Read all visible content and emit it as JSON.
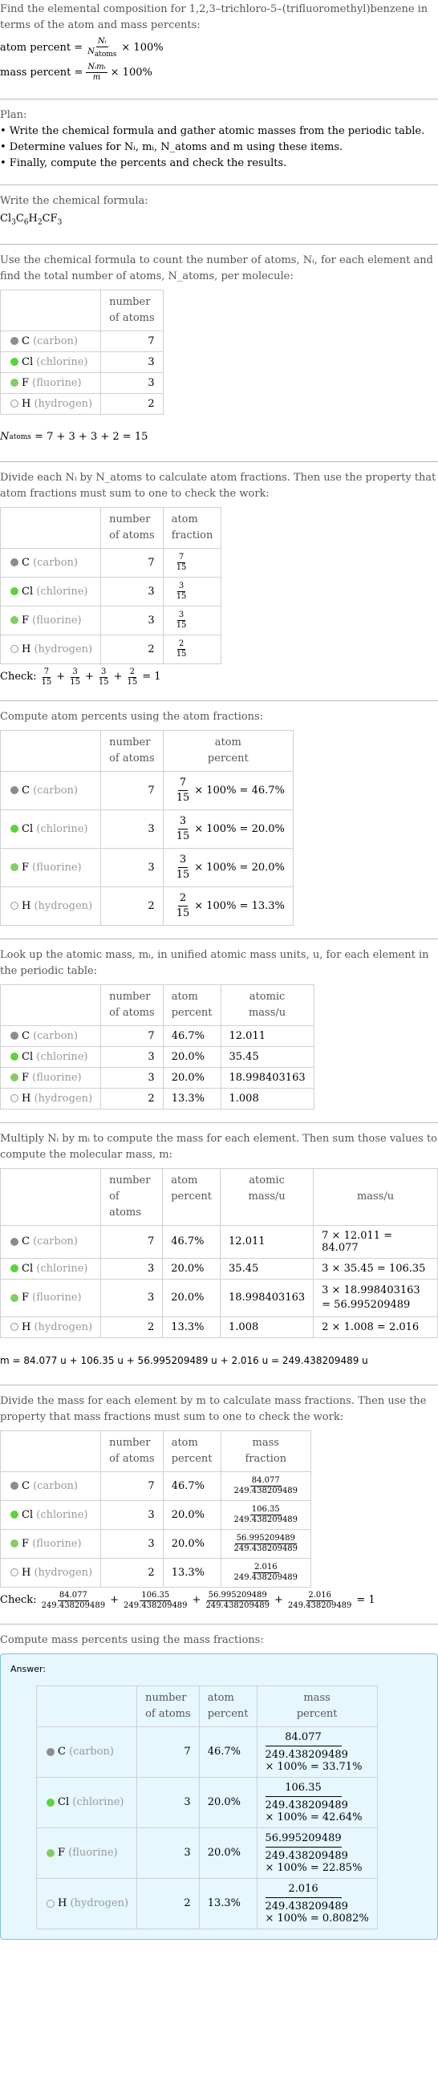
{
  "intro": {
    "text": "Find the elemental composition for 1,2,3–trichloro-5–(trifluoromethyl)benzene in terms of the atom and mass percents:",
    "atom_percent_label": "atom percent =",
    "atom_percent_num": "Nᵢ",
    "atom_percent_den": "N",
    "atom_percent_den_sub": "atoms",
    "mass_percent_label": "mass percent =",
    "mass_percent_num": "Nᵢmᵢ",
    "mass_percent_den": "m",
    "times_100": "× 100%"
  },
  "plan": {
    "title": "Plan:",
    "items": [
      "• Write the chemical formula and gather atomic masses from the periodic table.",
      "• Determine values for Nᵢ, mᵢ, N_atoms and m using these items.",
      "• Finally, compute the percents and check the results."
    ]
  },
  "formula": {
    "intro": "Write the chemical formula:",
    "parts": [
      {
        "s": "Cl",
        "n": "3"
      },
      {
        "s": "C",
        "n": "6"
      },
      {
        "s": "H",
        "n": "2"
      },
      {
        "s": "CF",
        "n": "3"
      }
    ]
  },
  "elements": [
    {
      "symbol": "C",
      "name": "(carbon)",
      "color": "#8c8c8c",
      "border": "#8c8c8c",
      "count": "7",
      "fraction_num": "7",
      "fraction_den": "15",
      "atom_percent": "46.7%",
      "atom_percent_expr": "× 100% = 46.7%",
      "atomic_mass": "12.011",
      "mass_expr": "7 × 12.011 = 84.077",
      "mass": "84.077",
      "mass_percent_expr": "× 100% = 33.71%"
    },
    {
      "symbol": "Cl",
      "name": "(chlorine)",
      "color": "#5cd43a",
      "border": "#5cd43a",
      "count": "3",
      "fraction_num": "3",
      "fraction_den": "15",
      "atom_percent": "20.0%",
      "atom_percent_expr": "× 100% = 20.0%",
      "atomic_mass": "35.45",
      "mass_expr": "3 × 35.45 = 106.35",
      "mass": "106.35",
      "mass_percent_expr": "× 100% = 42.64%"
    },
    {
      "symbol": "F",
      "name": "(fluorine)",
      "color": "#86cc62",
      "border": "#86cc62",
      "count": "3",
      "fraction_num": "3",
      "fraction_den": "15",
      "atom_percent": "20.0%",
      "atom_percent_expr": "× 100% = 20.0%",
      "atomic_mass": "18.998403163",
      "mass_expr": "3 × 18.998403163 = 56.995209489",
      "mass": "56.995209489",
      "mass_percent_expr": "× 100% = 22.85%"
    },
    {
      "symbol": "H",
      "name": "(hydrogen)",
      "color": "#eefaff",
      "border": "#999999",
      "count": "2",
      "fraction_num": "2",
      "fraction_den": "15",
      "atom_percent": "13.3%",
      "atom_percent_expr": "× 100% = 13.3%",
      "atomic_mass": "1.008",
      "mass_expr": "2 × 1.008 = 2.016",
      "mass": "2.016",
      "mass_percent_expr": "× 100% = 0.8082%"
    }
  ],
  "headers": {
    "number_of_atoms": [
      "number",
      "of atoms"
    ],
    "atom_fraction": [
      "atom",
      "fraction"
    ],
    "atom_percent": [
      "atom",
      "percent"
    ],
    "atomic_mass": [
      "atomic",
      "mass/u"
    ],
    "mass": "mass/u",
    "mass_fraction": [
      "mass",
      "fraction"
    ],
    "mass_percent": [
      "mass",
      "percent"
    ]
  },
  "step_count": {
    "intro": "Use the chemical formula to count the number of atoms, Nᵢ, for each element and find the total number of atoms, N_atoms, per molecule:",
    "total": "= 7 + 3 + 3 + 2 = 15"
  },
  "step_fraction": {
    "intro": "Divide each Nᵢ by N_atoms to calculate atom fractions. Then use the property that atom fractions must sum to one to check the work:",
    "check_label": "Check:",
    "check_result": "= 1"
  },
  "step_atom_percent": {
    "intro": "Compute atom percents using the atom fractions:"
  },
  "step_mass_lookup": {
    "intro": "Look up the atomic mass, mᵢ, in unified atomic mass units, u, for each element in the periodic table:"
  },
  "step_molecular_mass": {
    "intro": "Multiply Nᵢ by mᵢ to compute the mass for each element. Then sum those values to compute the molecular mass, m:",
    "equation": "m = 84.077 u + 106.35 u + 56.995209489 u + 2.016 u = 249.438209489 u"
  },
  "step_mass_fraction": {
    "intro": "Divide the mass for each element by m to calculate mass fractions. Then use the property that mass fractions must sum to one to check the work:",
    "denominator": "249.438209489",
    "check_label": "Check:",
    "check_result": "= 1"
  },
  "step_mass_percent": {
    "intro": "Compute mass percents using the mass fractions:",
    "answer_label": "Answer:"
  }
}
